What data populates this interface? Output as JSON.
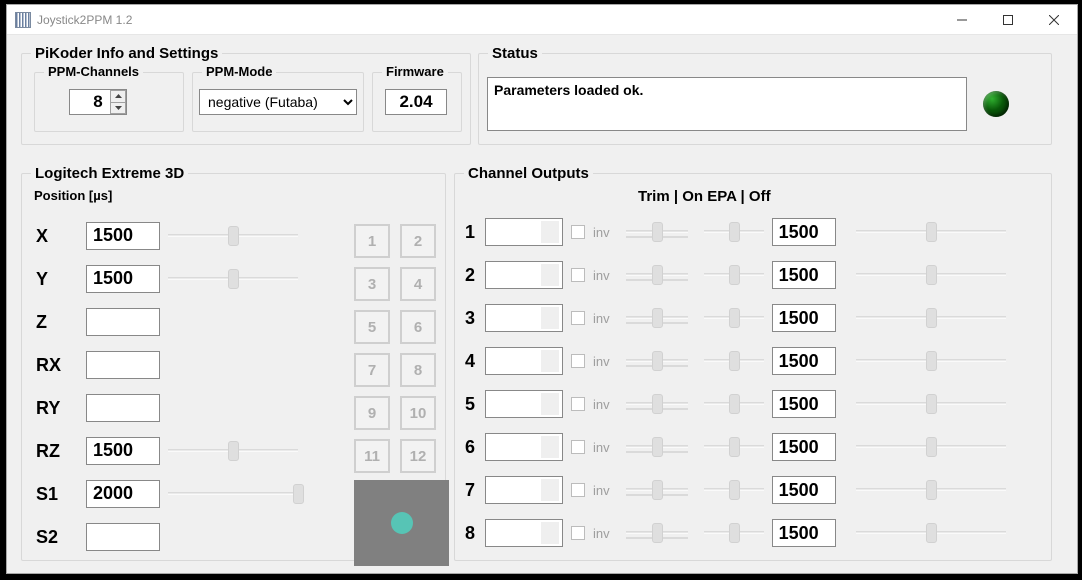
{
  "window": {
    "title": "Joystick2PPM 1.2"
  },
  "pikoder": {
    "legend": "PiKoder Info and Settings",
    "ppm_channels": {
      "legend": "PPM-Channels",
      "value": "8"
    },
    "ppm_mode": {
      "legend": "PPM-Mode",
      "value": "negative (Futaba)"
    },
    "firmware": {
      "legend": "Firmware",
      "value": "2.04"
    }
  },
  "status": {
    "legend": "Status",
    "text": "Parameters loaded ok."
  },
  "joystick": {
    "heading": "Logitech Extreme 3D",
    "position_label": "Position [µs]",
    "axes": [
      {
        "name": "X",
        "value": "1500",
        "slider": 50
      },
      {
        "name": "Y",
        "value": "1500",
        "slider": 50
      },
      {
        "name": "Z",
        "value": "",
        "slider": null
      },
      {
        "name": "RX",
        "value": "",
        "slider": null
      },
      {
        "name": "RY",
        "value": "",
        "slider": null
      },
      {
        "name": "RZ",
        "value": "1500",
        "slider": 50
      },
      {
        "name": "S1",
        "value": "2000",
        "slider": 100
      },
      {
        "name": "S2",
        "value": "",
        "slider": null
      }
    ],
    "buttons": [
      "1",
      "2",
      "3",
      "4",
      "5",
      "6",
      "7",
      "8",
      "9",
      "10",
      "11",
      "12"
    ]
  },
  "channels": {
    "heading": "Channel Outputs",
    "columns": "Trim | On   EPA | Off",
    "rows": [
      {
        "n": "1",
        "inv": "inv",
        "out": "1500"
      },
      {
        "n": "2",
        "inv": "inv",
        "out": "1500"
      },
      {
        "n": "3",
        "inv": "inv",
        "out": "1500"
      },
      {
        "n": "4",
        "inv": "inv",
        "out": "1500"
      },
      {
        "n": "5",
        "inv": "inv",
        "out": "1500"
      },
      {
        "n": "6",
        "inv": "inv",
        "out": "1500"
      },
      {
        "n": "7",
        "inv": "inv",
        "out": "1500"
      },
      {
        "n": "8",
        "inv": "inv",
        "out": "1500"
      }
    ]
  }
}
